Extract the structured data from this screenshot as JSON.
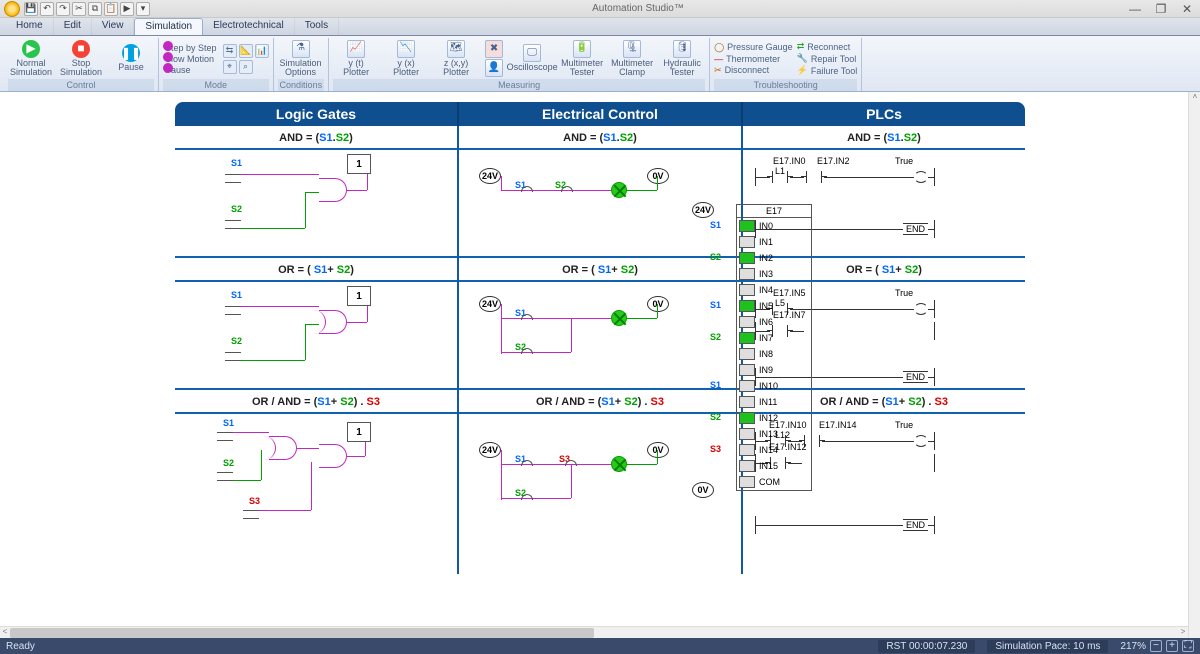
{
  "app_title": "Automation Studio™",
  "window_buttons": {
    "min": "—",
    "max": "❐",
    "close": "✕"
  },
  "tabs": {
    "home": "Home",
    "edit": "Edit",
    "view": "View",
    "simulation": "Simulation",
    "electrotechnical": "Electrotechnical",
    "tools": "Tools"
  },
  "ribbon": {
    "groups": {
      "control": "Control",
      "mode": "Mode",
      "conditions": "Conditions",
      "measuring": "Measuring",
      "trouble": "Troubleshooting"
    },
    "normal_sim": "Normal\nSimulation",
    "stop_sim": "Stop\nSimulation",
    "pause": "Pause",
    "step": "Step by Step",
    "slow": "Slow Motion",
    "sim_options": "Simulation\nOptions",
    "plot_y": "y (t)\nPlotter",
    "plot_yt": "y (x)\nPlotter",
    "plot_z": "z (x,y)\nPlotter",
    "oscilloscope": "Oscilloscope",
    "multimeter": "Multimeter\nTester",
    "clamp": "Multimeter\nClamp",
    "hydraulic": "Hydraulic\nTester",
    "pressure": "Pressure Gauge",
    "thermo": "Thermometer",
    "disconnect": "Disconnect",
    "reconnect": "Reconnect",
    "repair": "Repair Tool",
    "failure": "Failure Tool"
  },
  "workspace": {
    "headers": {
      "logic": "Logic Gates",
      "elec": "Electrical Control",
      "plc": "PLCs"
    },
    "and_title_pre": "AND = (",
    "and_s1": "S1",
    "and_dot": ".",
    "and_s2": "S2",
    "and_close": ")",
    "or_title_pre": "OR = ( ",
    "or_plus": "+ ",
    "orand_title_pre": "OR / AND = (",
    "orand_mid": ") . ",
    "s1": "S1",
    "s2": "S2",
    "s3": "S3",
    "one": "1",
    "v24": "24V",
    "v0": "0V",
    "plc_name": "E17",
    "plc_inputs": [
      "IN0",
      "IN1",
      "IN2",
      "IN3",
      "IN4",
      "IN5",
      "IN6",
      "IN7",
      "IN8",
      "IN9",
      "IN10",
      "IN11",
      "IN12",
      "IN13",
      "IN14",
      "IN15",
      "COM"
    ],
    "L1": "L1",
    "L5": "L5",
    "L12": "L12",
    "true": "True",
    "end": "END",
    "e17_in0": "E17.IN0",
    "e17_in2": "E17.IN2",
    "e17_in5": "E17.IN5",
    "e17_in7": "E17.IN7",
    "e17_in10": "E17.IN10",
    "e17_in12": "E17.IN12",
    "e17_in14": "E17.IN14"
  },
  "status": {
    "ready": "Ready",
    "rst": "RST 00:00:07.230",
    "pace": "Simulation Pace: 10 ms",
    "zoom": "217%"
  }
}
